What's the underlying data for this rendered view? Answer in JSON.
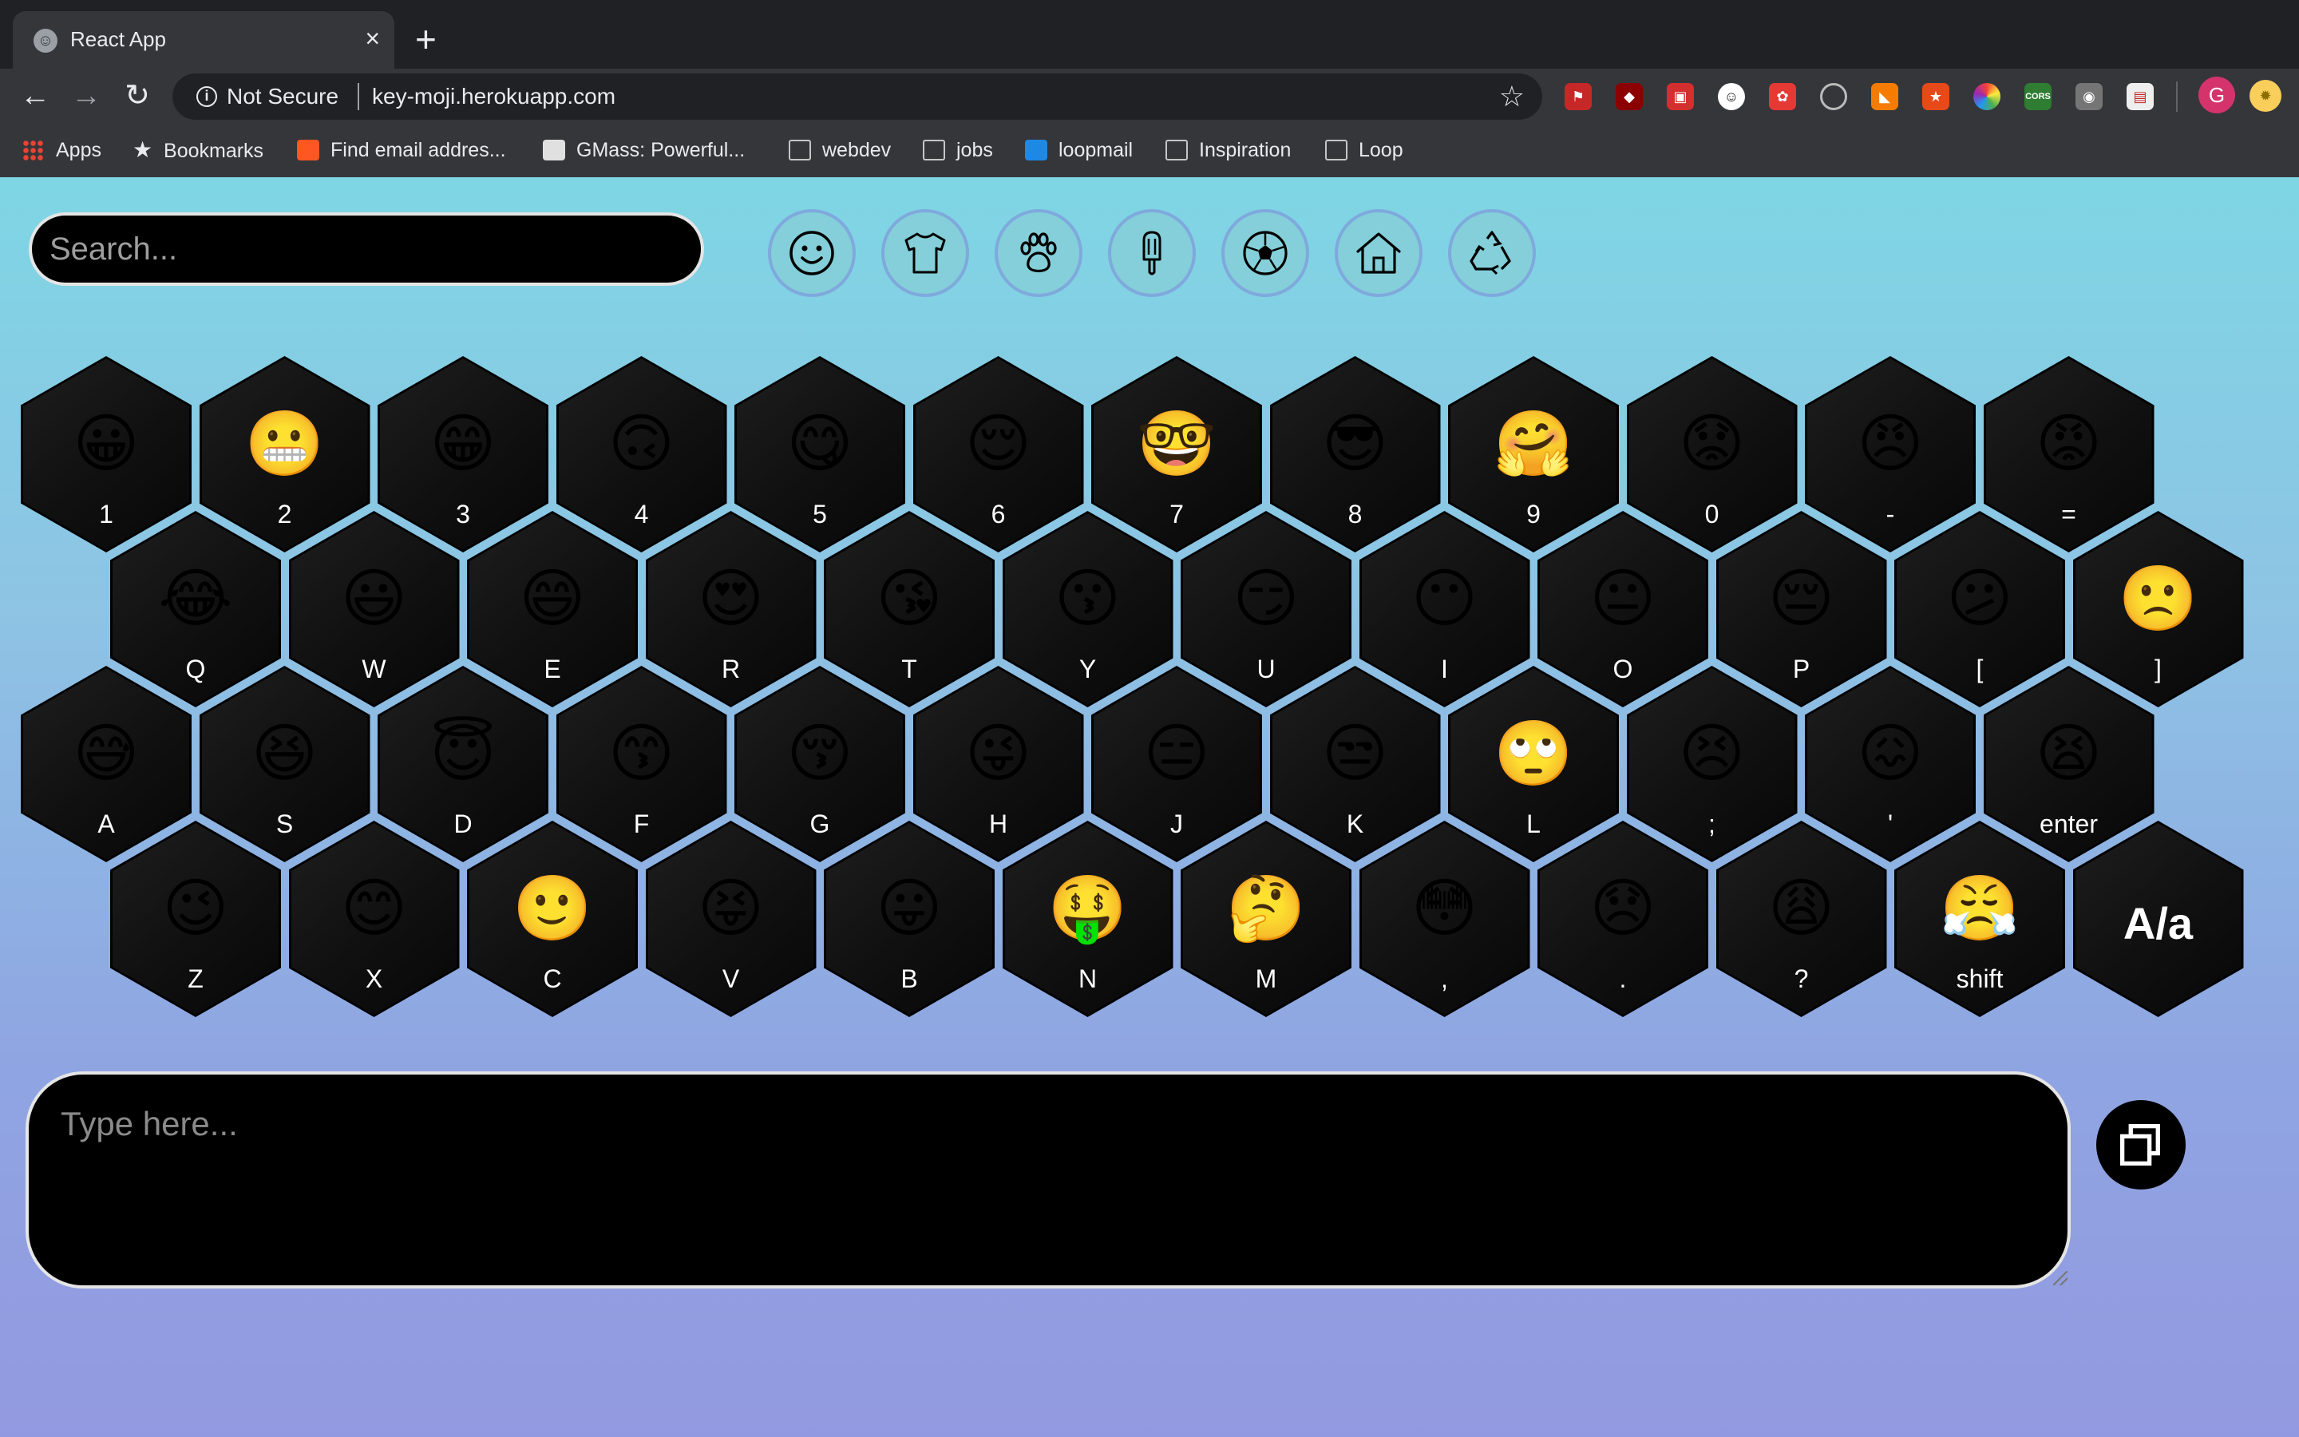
{
  "browser": {
    "tab_title": "React App",
    "new_tab_symbol": "+",
    "security_label": "Not Secure",
    "url": "key-moji.herokuapp.com",
    "profile_initial": "G",
    "bookmarks": [
      "Apps",
      "Bookmarks",
      "Find email addres...",
      "GMass: Powerful...",
      "webdev",
      "jobs",
      "loopmail",
      "Inspiration",
      "Loop"
    ]
  },
  "search": {
    "placeholder": "Search..."
  },
  "categories": [
    "smileys",
    "clothing",
    "animals",
    "food",
    "activities",
    "places",
    "symbols"
  ],
  "keyboard": {
    "row1": [
      {
        "emoji": "😀",
        "label": "1"
      },
      {
        "emoji": "😬",
        "label": "2"
      },
      {
        "emoji": "😁",
        "label": "3"
      },
      {
        "emoji": "🙃",
        "label": "4"
      },
      {
        "emoji": "😋",
        "label": "5"
      },
      {
        "emoji": "😌",
        "label": "6"
      },
      {
        "emoji": "🤓",
        "label": "7"
      },
      {
        "emoji": "😎",
        "label": "8"
      },
      {
        "emoji": "🤗",
        "label": "9"
      },
      {
        "emoji": "😟",
        "label": "0"
      },
      {
        "emoji": "😠",
        "label": "-"
      },
      {
        "emoji": "😡",
        "label": "="
      }
    ],
    "row2": [
      {
        "emoji": "😂",
        "label": "Q"
      },
      {
        "emoji": "😃",
        "label": "W"
      },
      {
        "emoji": "😄",
        "label": "E"
      },
      {
        "emoji": "😍",
        "label": "R"
      },
      {
        "emoji": "😘",
        "label": "T"
      },
      {
        "emoji": "😗",
        "label": "Y"
      },
      {
        "emoji": "😏",
        "label": "U"
      },
      {
        "emoji": "😶",
        "label": "I"
      },
      {
        "emoji": "😐",
        "label": "O"
      },
      {
        "emoji": "😔",
        "label": "P"
      },
      {
        "emoji": "😕",
        "label": "["
      },
      {
        "emoji": "🙁",
        "label": "]"
      }
    ],
    "row3": [
      {
        "emoji": "😅",
        "label": "A"
      },
      {
        "emoji": "😆",
        "label": "S"
      },
      {
        "emoji": "😇",
        "label": "D"
      },
      {
        "emoji": "😙",
        "label": "F"
      },
      {
        "emoji": "😚",
        "label": "G"
      },
      {
        "emoji": "😜",
        "label": "H"
      },
      {
        "emoji": "😑",
        "label": "J"
      },
      {
        "emoji": "😒",
        "label": "K"
      },
      {
        "emoji": "🙄",
        "label": "L"
      },
      {
        "emoji": "😣",
        "label": ";"
      },
      {
        "emoji": "😖",
        "label": "'"
      },
      {
        "emoji": "😫",
        "label": "enter"
      }
    ],
    "row4": [
      {
        "emoji": "😉",
        "label": "Z"
      },
      {
        "emoji": "😊",
        "label": "X"
      },
      {
        "emoji": "🙂",
        "label": "C"
      },
      {
        "emoji": "😝",
        "label": "V"
      },
      {
        "emoji": "😛",
        "label": "B"
      },
      {
        "emoji": "🤑",
        "label": "N"
      },
      {
        "emoji": "🤔",
        "label": "M"
      },
      {
        "emoji": "😳",
        "label": ","
      },
      {
        "emoji": "😞",
        "label": "."
      },
      {
        "emoji": "😩",
        "label": "?"
      },
      {
        "emoji": "😤",
        "label": "shift"
      },
      {
        "emoji": "",
        "label": "",
        "big": "A/a"
      }
    ]
  },
  "typing": {
    "placeholder": "Type here..."
  },
  "colors": {
    "accent_ring": "#7fa9dd",
    "key_bg": "#111111",
    "page_top": "#7ed6e4",
    "page_bottom": "#9399e0"
  }
}
